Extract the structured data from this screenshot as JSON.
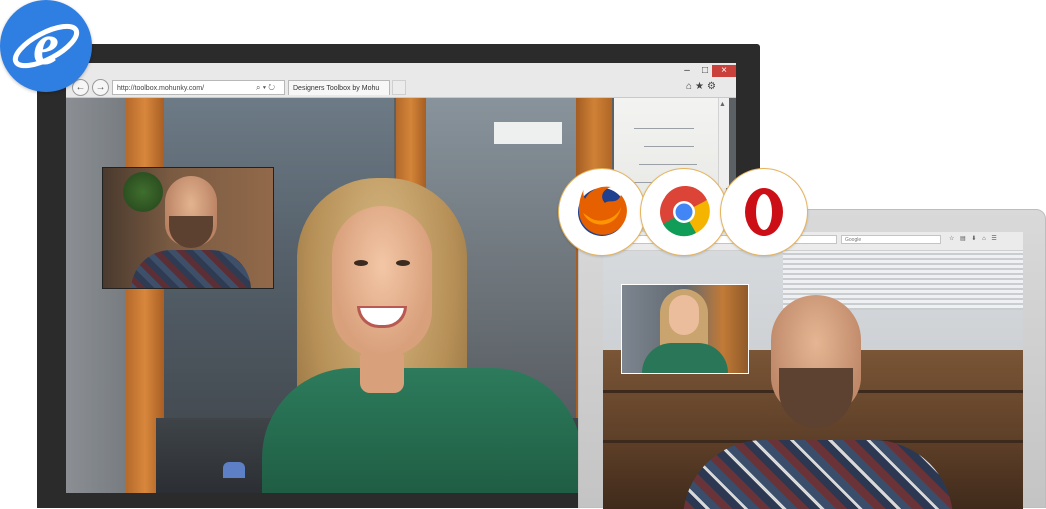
{
  "ie_window": {
    "url": "http://toolbox.mohunky.com/",
    "tab_title": "Designers Toolbox by Mohu",
    "window_controls": {
      "minimize": "–",
      "maximize": "□",
      "close": "×"
    },
    "nav": {
      "back": "←",
      "forward": "→"
    },
    "address_tools": "⌕ ▾ ↻",
    "toolbar_icons": "⌂★⚙",
    "scroll_up": "▲"
  },
  "laptop_window": {
    "search_placeholder": "Google"
  },
  "browsers": [
    "internet-explorer",
    "firefox",
    "chrome",
    "opera"
  ],
  "colors": {
    "ie_blue": "#2f7ee2",
    "firefox_orange": "#e66000",
    "chrome_red": "#db4437",
    "chrome_yellow": "#f4b400",
    "chrome_green": "#0f9d58",
    "chrome_blue": "#4285f4",
    "opera_red": "#cc0f16",
    "circle_border": "#e6b35b"
  }
}
